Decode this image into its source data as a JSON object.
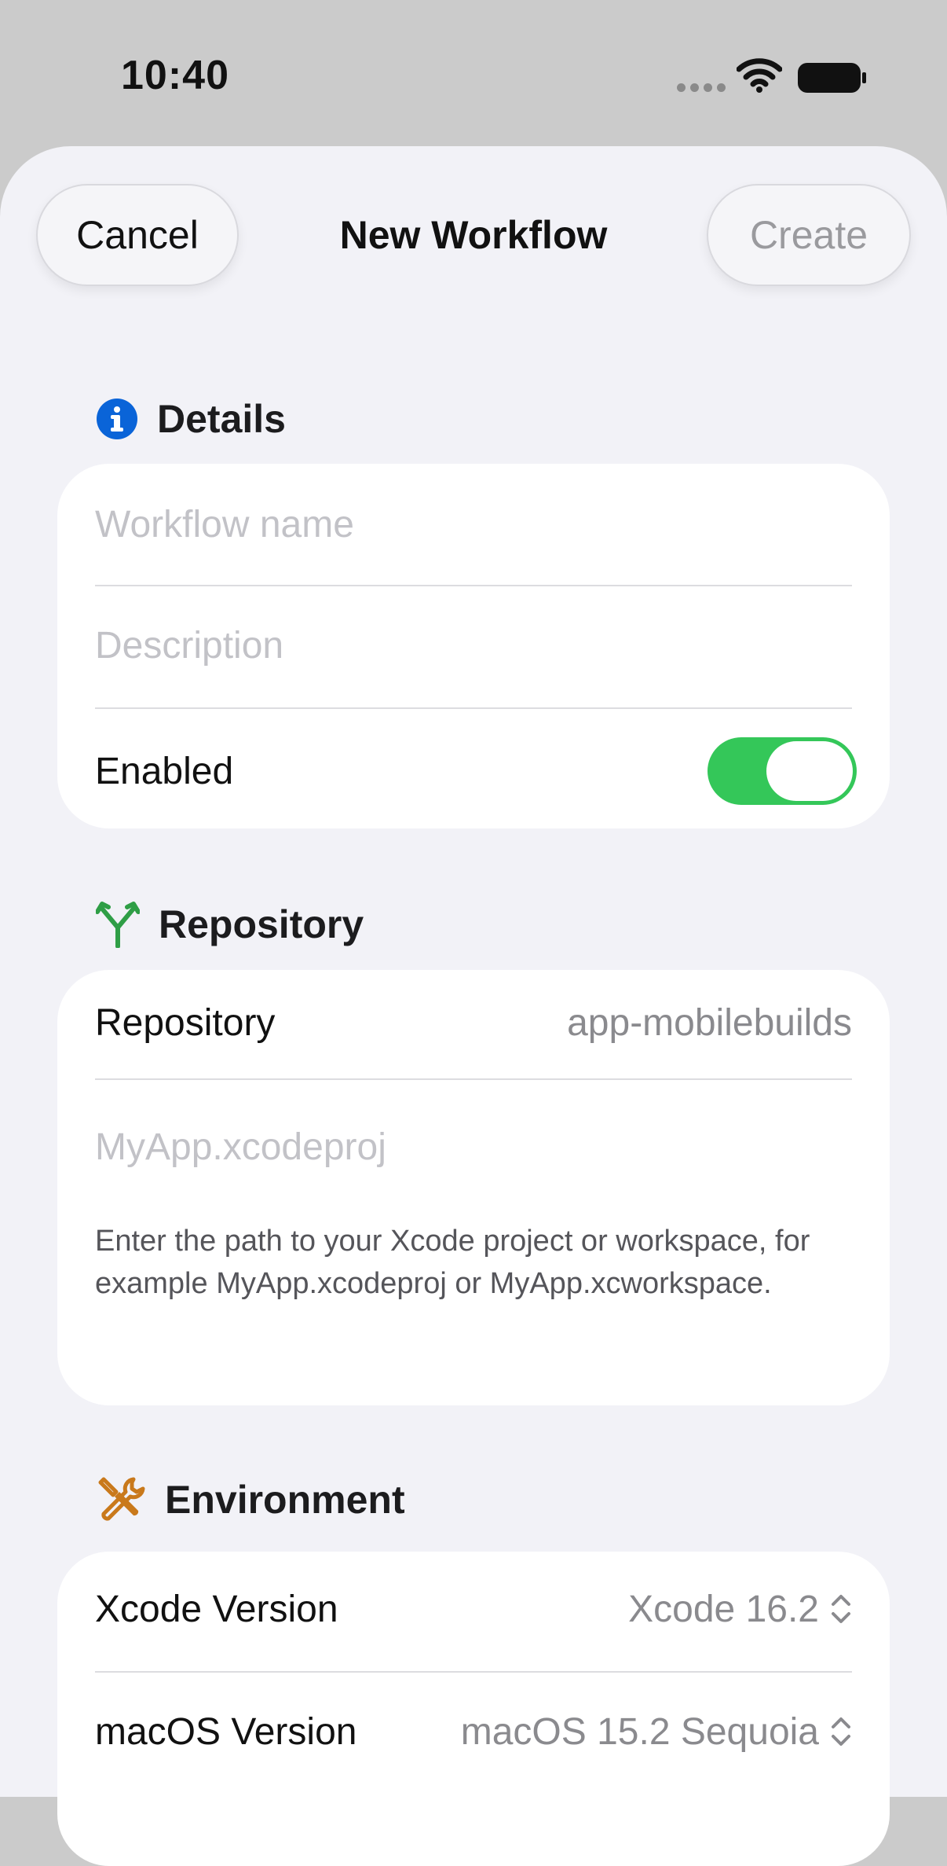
{
  "status_bar": {
    "time": "10:40"
  },
  "nav": {
    "cancel_label": "Cancel",
    "title": "New Workflow",
    "create_label": "Create"
  },
  "details": {
    "header": "Details",
    "name_placeholder": "Workflow name",
    "description_placeholder": "Description",
    "enabled_label": "Enabled",
    "enabled": true
  },
  "repository": {
    "header": "Repository",
    "repo_label": "Repository",
    "repo_value": "app-mobilebuilds",
    "project_placeholder": "MyApp.xcodeproj",
    "footnote": "Enter the path to your Xcode project or workspace, for example MyApp.xcodeproj or MyApp.xcworkspace."
  },
  "environment": {
    "header": "Environment",
    "xcode_label": "Xcode Version",
    "xcode_value": "Xcode 16.2",
    "macos_label": "macOS Version",
    "macos_value": "macOS 15.2 Sequoia"
  },
  "colors": {
    "accent_green": "#34c759",
    "info_blue": "#0a64d8",
    "repo_green": "#2f9e46",
    "env_orange": "#c9791b"
  },
  "icons": [
    "info-icon",
    "branch-icon",
    "tools-icon",
    "chevron-updown-icon",
    "wifi-icon",
    "battery-icon"
  ]
}
